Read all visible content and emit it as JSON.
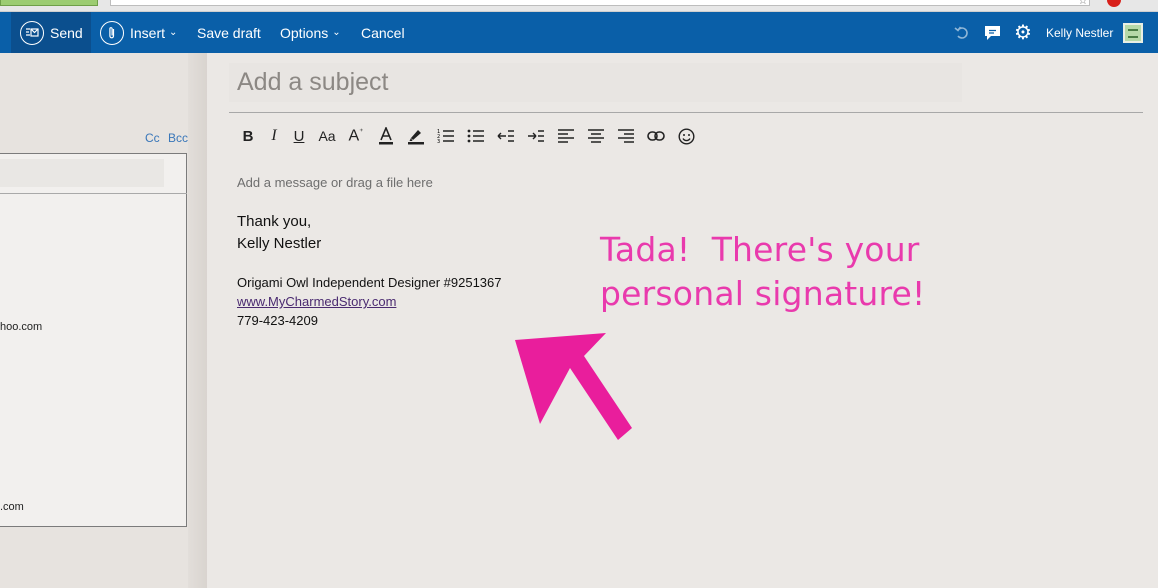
{
  "toolbar": {
    "send_label": "Send",
    "insert_label": "Insert",
    "save_draft_label": "Save draft",
    "options_label": "Options",
    "cancel_label": "Cancel",
    "user_name": "Kelly Nestler"
  },
  "recipients": {
    "cc_label": "Cc",
    "bcc_label": "Bcc",
    "visible_addresses": [
      "hoo.com",
      ".com"
    ]
  },
  "compose": {
    "subject_placeholder": "Add a subject",
    "body_placeholder": "Add a message or drag a file here",
    "signature": {
      "closing": "Thank you,",
      "name": "Kelly Nestler",
      "title": "Origami Owl Independent Designer #9251367",
      "website": "www.MyCharmedStory.com",
      "phone": "779-423-4209"
    }
  },
  "format_toolbar": {
    "bold": "B",
    "italic": "I",
    "underline": "U",
    "font_size": "Aa",
    "grow_font": "A"
  },
  "annotation": {
    "line1": "Tada!  There's your",
    "line2": "personal signature!",
    "color": "#e93aad"
  },
  "colors": {
    "command_bar": "#0a5fa8",
    "send_button_bg": "#0b4f8e",
    "arrow": "#e91e9c"
  }
}
